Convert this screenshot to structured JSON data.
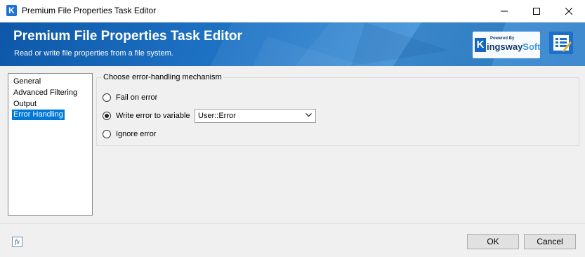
{
  "window": {
    "icon_letter": "K",
    "title": "Premium File Properties Task Editor"
  },
  "banner": {
    "title": "Premium File Properties Task Editor",
    "subtitle": "Read or write file properties from a file system.",
    "logo_powered": "Powered By",
    "logo_k": "K",
    "logo_word_main": "ingsway",
    "logo_word_soft": "Soft"
  },
  "nav": {
    "items": [
      "General",
      "Advanced Filtering",
      "Output",
      "Error Handling"
    ],
    "selected_index": 3
  },
  "error_group": {
    "legend": "Choose error-handling mechanism",
    "options": [
      "Fail on error",
      "Write error to variable",
      "Ignore error"
    ],
    "selected_index": 1,
    "variable_value": "User::Error"
  },
  "footer": {
    "fx_label": "fx",
    "ok_label": "OK",
    "cancel_label": "Cancel"
  },
  "colors": {
    "accent": "#0078d7",
    "banner": "#1f74c6"
  }
}
